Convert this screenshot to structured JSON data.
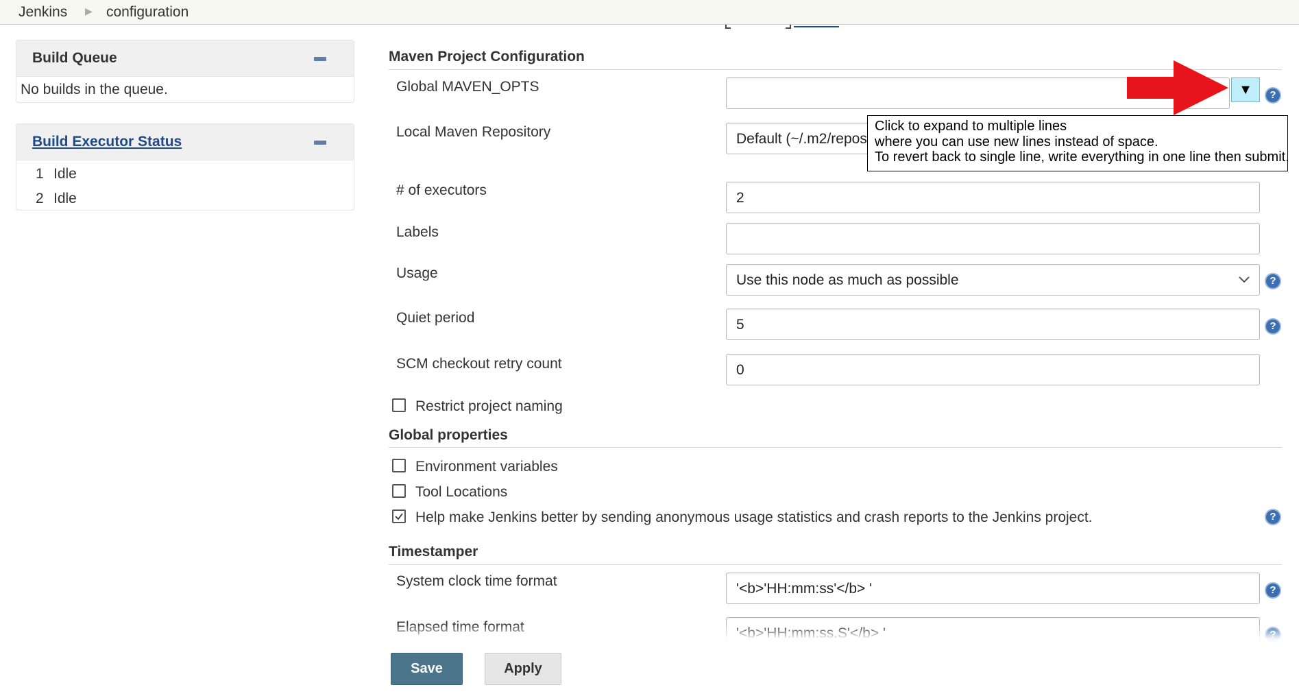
{
  "breadcrumb": {
    "root": "Jenkins",
    "current": "configuration"
  },
  "sidebar": {
    "build_queue": {
      "title": "Build Queue",
      "empty_text": "No builds in the queue."
    },
    "executor_status": {
      "title": "Build Executor Status",
      "executors": [
        {
          "number": "1",
          "status": "Idle"
        },
        {
          "number": "2",
          "status": "Idle"
        }
      ]
    }
  },
  "maven": {
    "section_title": "Maven Project Configuration",
    "global_maven_opts": {
      "label": "Global MAVEN_OPTS",
      "value": ""
    },
    "expand_button_symbol": "▼",
    "tooltip": {
      "lines": [
        "Click to expand to multiple lines",
        "where you can use new lines instead of space.",
        "To revert back to single line, write everything in one line then submit."
      ]
    },
    "local_repo": {
      "label": "Local Maven Repository",
      "value": "Default (~/.m2/reposit"
    }
  },
  "node": {
    "executors": {
      "label": "# of executors",
      "value": "2"
    },
    "labels": {
      "label": "Labels",
      "value": ""
    },
    "usage": {
      "label": "Usage",
      "selected": "Use this node as much as possible"
    },
    "quiet_period": {
      "label": "Quiet period",
      "value": "5"
    },
    "scm_retry": {
      "label": "SCM checkout retry count",
      "value": "0"
    },
    "restrict_naming": {
      "label": "Restrict project naming",
      "checked": false
    }
  },
  "global_properties": {
    "section_title": "Global properties",
    "env_vars": {
      "label": "Environment variables",
      "checked": false
    },
    "tool_locations": {
      "label": "Tool Locations",
      "checked": false
    },
    "usage_stats": {
      "label": "Help make Jenkins better by sending anonymous usage statistics and crash reports to the Jenkins project.",
      "checked": true
    }
  },
  "timestamper": {
    "section_title": "Timestamper",
    "system_clock": {
      "label": "System clock time format",
      "value": "'<b>'HH:mm:ss'</b> '"
    },
    "elapsed": {
      "label": "Elapsed time format",
      "value": "'<b>'HH:mm:ss.S'</b> '"
    }
  },
  "actions": {
    "save_label": "Save",
    "apply_label": "Apply"
  },
  "icons": {
    "help": "help-circle-icon",
    "collapse": "minus-icon",
    "breadcrumb_separator": "triangle-right-icon",
    "dropdown": "chevron-down-icon"
  },
  "colors": {
    "annotation_arrow": "#e8141b",
    "save_button": "#4b758b",
    "help_icon": "#3c6fb0",
    "link": "#204a87"
  }
}
